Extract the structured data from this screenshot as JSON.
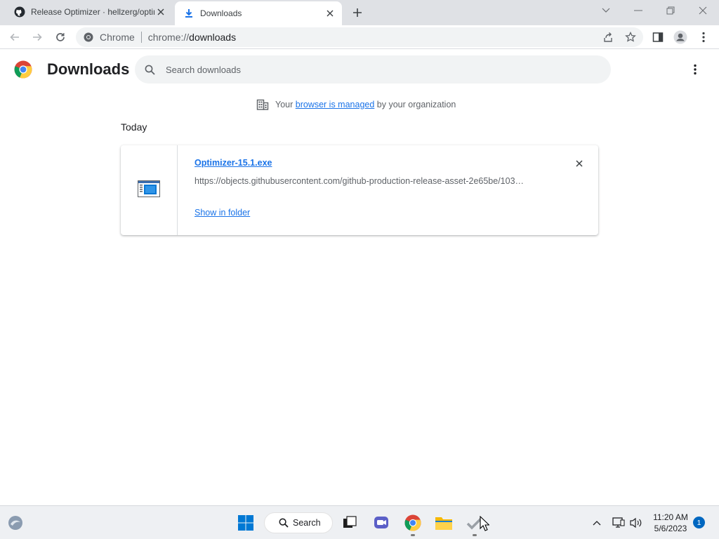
{
  "tabs": [
    {
      "title": "Release Optimizer · hellzerg/optimizer",
      "icon": "github-icon",
      "active": false
    },
    {
      "title": "Downloads",
      "icon": "download-icon",
      "active": true
    }
  ],
  "omnibox": {
    "chip_label": "Chrome",
    "url_host": "chrome://",
    "url_path": "downloads"
  },
  "page": {
    "title": "Downloads",
    "search_placeholder": "Search downloads",
    "managed": {
      "prefix": "Your",
      "link": "browser is managed",
      "suffix": "by your organization"
    },
    "sections": [
      {
        "date": "Today",
        "items": [
          {
            "filename": "Optimizer-15.1.exe",
            "url": "https://objects.githubusercontent.com/github-production-release-asset-2e65be/103…",
            "action": "Show in folder",
            "icon": "exe-file-icon"
          }
        ]
      }
    ]
  },
  "taskbar": {
    "search_label": "Search",
    "clock_time": "11:20 AM",
    "clock_date": "5/6/2023",
    "notification_count": "1"
  },
  "colors": {
    "accent": "#1a73e8",
    "tabstrip": "#dfe1e5",
    "omnibox": "#f1f3f4",
    "taskbar": "#eef0f3"
  }
}
